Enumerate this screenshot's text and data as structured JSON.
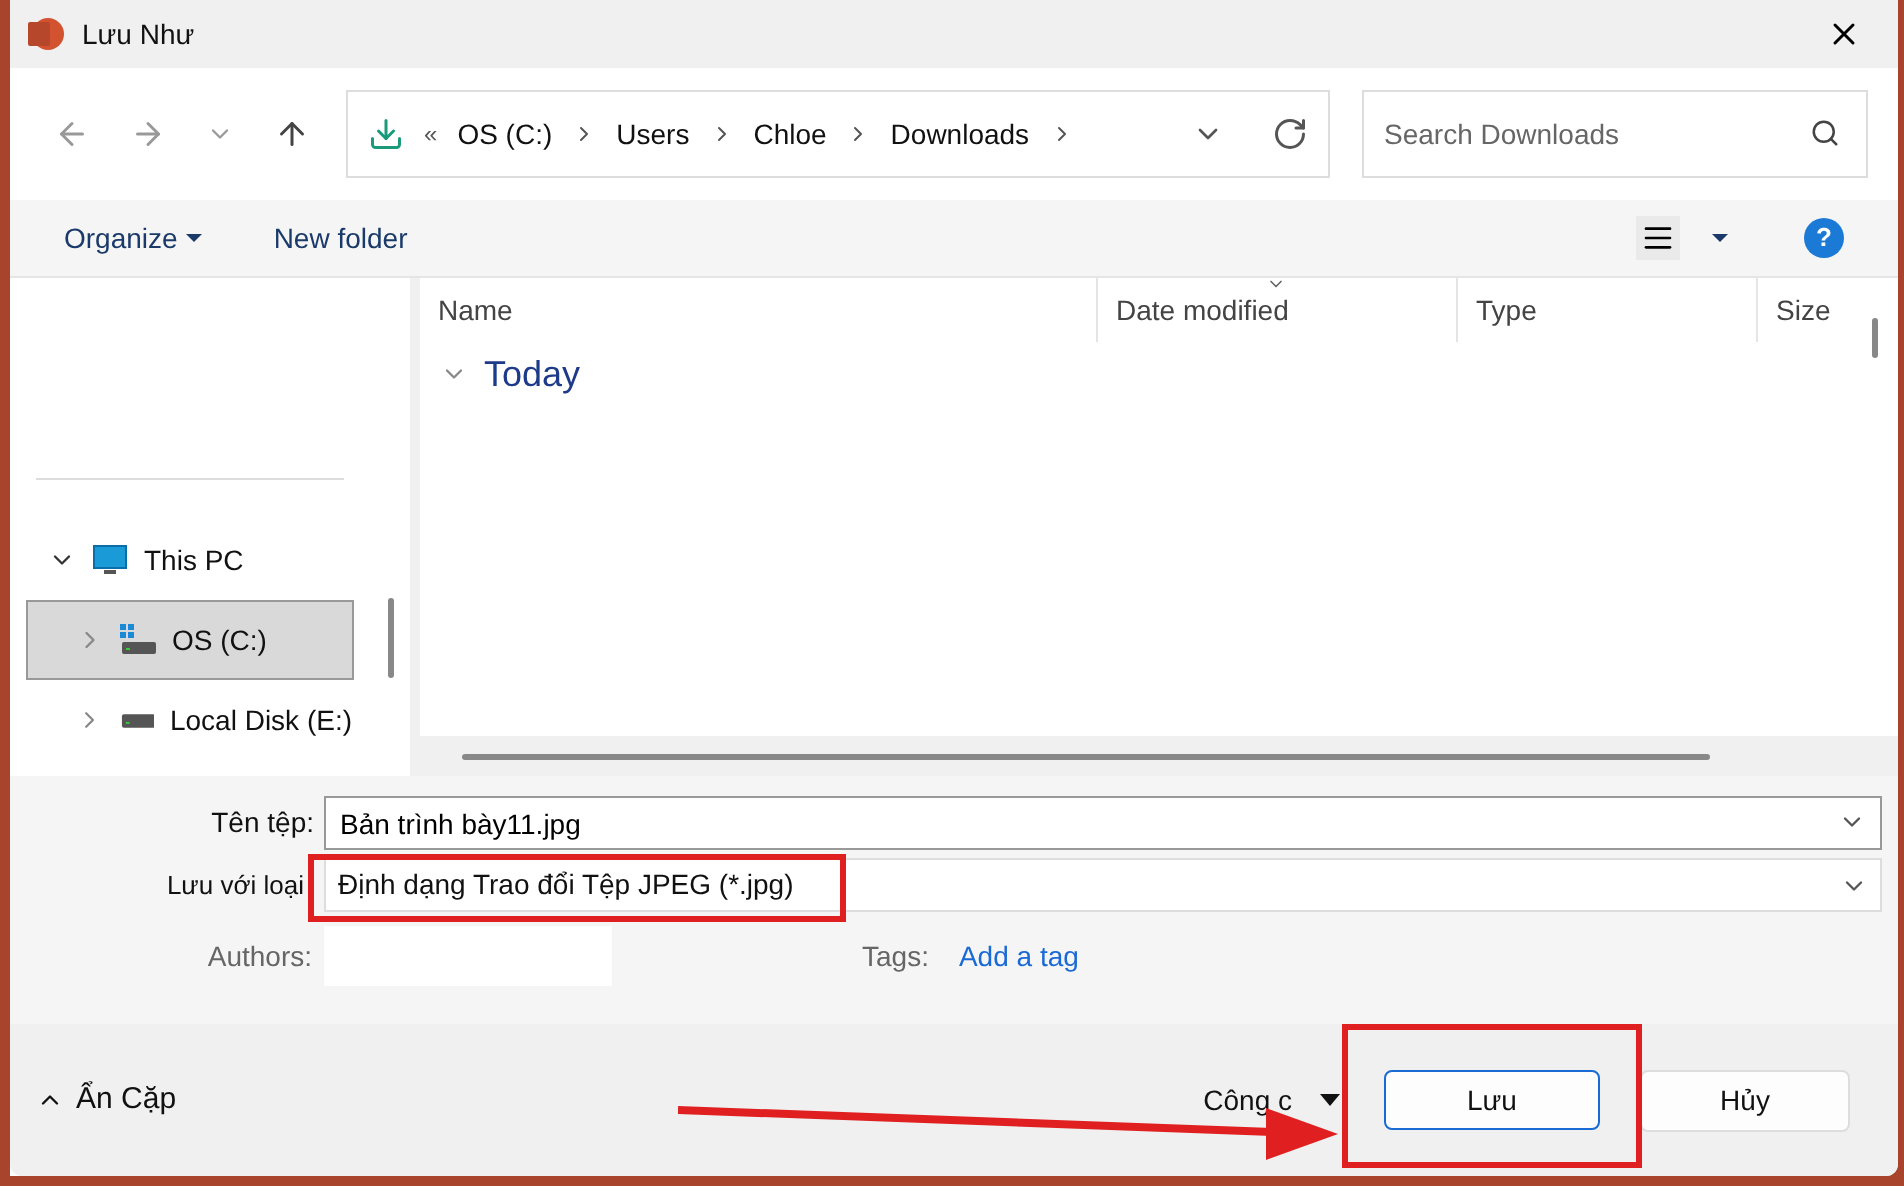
{
  "window": {
    "title": "Lưu Như"
  },
  "navigation": {
    "overflow": "«",
    "path": [
      "OS (C:)",
      "Users",
      "Chloe",
      "Downloads"
    ],
    "search": {
      "placeholder": "Search Downloads"
    }
  },
  "toolbar": {
    "organize": "Organize",
    "new_folder": "New folder",
    "help": "?"
  },
  "sidebar": {
    "items": [
      {
        "label": "This PC",
        "kind": "computer",
        "expanded": true,
        "selected": false,
        "children": [
          {
            "label": "OS (C:)",
            "kind": "system_drive",
            "expanded": false,
            "selected": true
          },
          {
            "label": "Local Disk (E:)",
            "kind": "drive",
            "expanded": false,
            "selected": false
          }
        ]
      }
    ]
  },
  "file_list": {
    "columns": [
      "Name",
      "Date modified",
      "Type",
      "Size"
    ],
    "groups": [
      {
        "label": "Today",
        "expanded": true
      }
    ]
  },
  "form": {
    "file_name": {
      "label": "Tên tệp:",
      "value": "Bản trình bày11.jpg"
    },
    "save_type": {
      "label": "Lưu với loại",
      "value": "Định dạng Trao đổi Tệp JPEG (*.jpg)"
    },
    "authors": {
      "label": "Authors:"
    },
    "tags": {
      "label": "Tags:",
      "link": "Add a tag"
    }
  },
  "footer": {
    "hide_folders": "Ẩn Cặp",
    "tools": "Công c",
    "save": "Lưu",
    "cancel": "Hủy"
  }
}
